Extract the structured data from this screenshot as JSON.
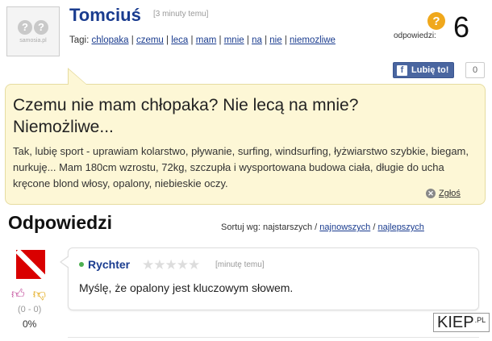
{
  "question": {
    "avatar_logo": "samosia.pl",
    "author": "Tomciuś",
    "time": "[3 minuty temu]",
    "tags_label": "Tagi:",
    "tags": [
      "chlopaka",
      "czemu",
      "leca",
      "mam",
      "mnie",
      "na",
      "nie",
      "niemozliwe"
    ],
    "answers_label": "odpowiedzi:",
    "answers_count": "6",
    "like_label": "Lubię to!",
    "like_count": "0",
    "title": "Czemu nie mam chłopaka? Nie lecą na mnie? Niemożliwe...",
    "body": "Tak, lubię sport - uprawiam kolarstwo, pływanie, surfing, windsurfing, łyżwiarstwo szybkie, biegam, nurkuję... Mam 180cm wzrostu, 72kg, szczupła i wysportowana budowa ciała, długie do ucha kręcone blond włosy, opalony, niebieskie oczy.",
    "report_label": "Zgłoś"
  },
  "answers_section": {
    "heading": "Odpowiedzi",
    "sort_label": "Sortuj wg: najstarszych /",
    "sort_newest": "najnowszych",
    "sort_sep": "/",
    "sort_best": "najlepszych"
  },
  "answer": {
    "author": "Rychter",
    "stars": "★★★★★",
    "rating": 0,
    "time": "[minutę temu]",
    "body": "Myślę, że opalony jest kluczowym słowem.",
    "votes": "(0 - 0)",
    "percent": "0%"
  },
  "watermark": {
    "name": "KIEP",
    "suffix": ".PL"
  },
  "colors": {
    "link": "#1a3c8f",
    "question_bg": "#fdf7d6",
    "facebook": "#4a66a0",
    "accent_orange": "#f0a81c"
  }
}
